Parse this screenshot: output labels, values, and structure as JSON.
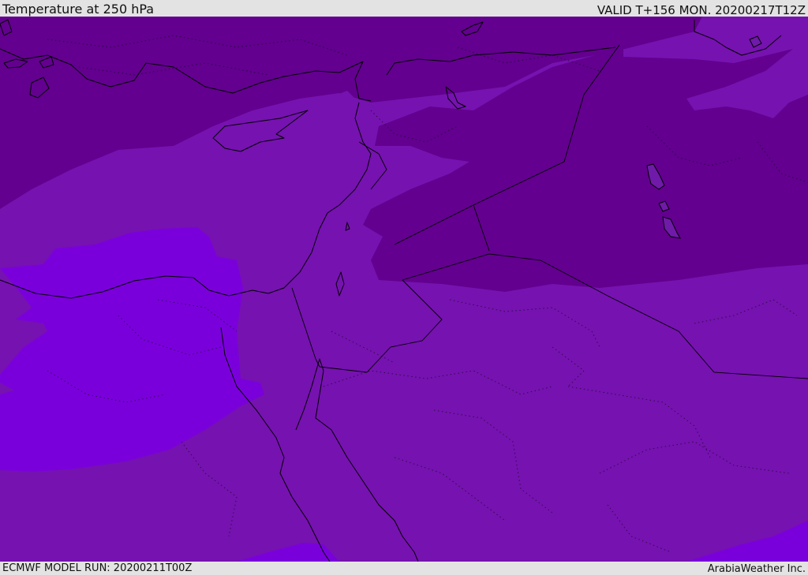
{
  "header": {
    "title": "Temperature at 250 hPa",
    "valid": "VALID T+156 MON. 20200217T12Z"
  },
  "footer": {
    "model_run": "ECMWF MODEL RUN: 20200211T00Z",
    "brand": "ArabiaWeather Inc."
  },
  "map": {
    "colors": {
      "coldest_band": "#63008f",
      "cold_band": "#7612b0",
      "mild_band": "#7a00db",
      "coastline": "#000000"
    }
  }
}
